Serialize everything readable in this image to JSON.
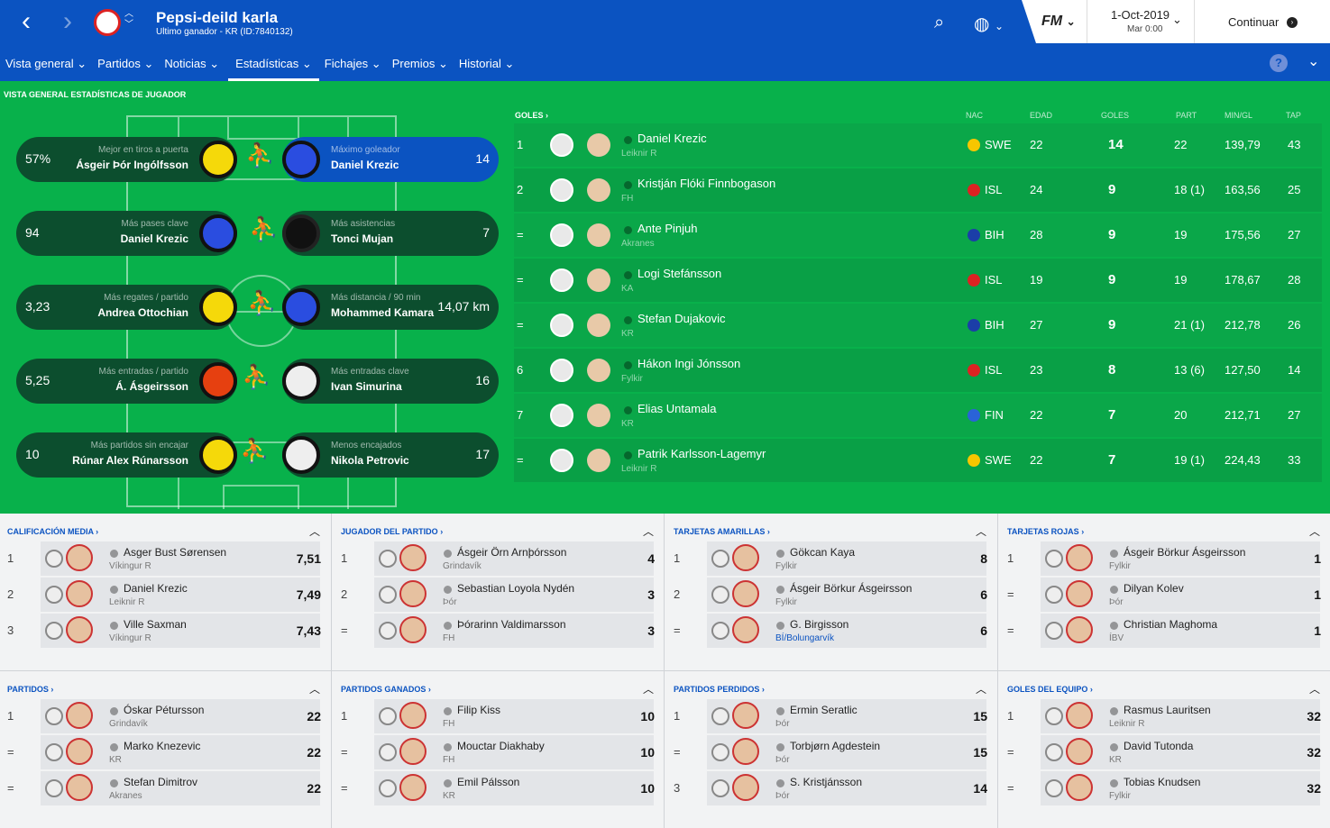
{
  "header": {
    "title": "Pepsi-deild karla",
    "subtitle": "Ultimo ganador - KR (ID:7840132)",
    "fm": "FM",
    "date": "1-Oct-2019",
    "time": "Mar 0:00",
    "continue": "Continuar"
  },
  "tabs": [
    "Vista general",
    "Partidos",
    "Noticias",
    "Estadísticas",
    "Fichajes",
    "Premios",
    "Historial"
  ],
  "section_title": "VISTA GENERAL ESTADÍSTICAS DE JUGADOR",
  "stats": [
    {
      "lval": "57%",
      "lcap": "Mejor en tiros a puerta",
      "lname": "Ásgeir Þór Ingólfsson",
      "rcap": "Máximo goleador",
      "rname": "Daniel Krezic",
      "rval": "14"
    },
    {
      "lval": "94",
      "lcap": "Más pases clave",
      "lname": "Daniel Krezic",
      "rcap": "Más asistencias",
      "rname": "Tonci Mujan",
      "rval": "7"
    },
    {
      "lval": "3,23",
      "lcap": "Más regates / partido",
      "lname": "Andrea Ottochian",
      "rcap": "Más distancia / 90 min",
      "rname": "Mohammed Kamara",
      "rval": "14,07 km"
    },
    {
      "lval": "5,25",
      "lcap": "Más entradas / partido",
      "lname": "Á. Ásgeirsson",
      "rcap": "Más entradas clave",
      "rname": "Ivan Simurina",
      "rval": "16"
    },
    {
      "lval": "10",
      "lcap": "Más partidos sin encajar",
      "lname": "Rúnar Alex Rúnarsson",
      "rcap": "Menos encajados",
      "rname": "Nikola Petrovic",
      "rval": "17"
    }
  ],
  "goals": {
    "title": "GOLES",
    "headers": [
      "NAC",
      "EDAD",
      "GOLES",
      "PART",
      "MIN/GL",
      "TAP"
    ],
    "rows": [
      {
        "rank": "1",
        "name": "Daniel Krezic",
        "club": "Leiknir R",
        "nat": "SWE",
        "age": "22",
        "goals": "14",
        "apps": "22",
        "mpg": "139,79",
        "tap": "43"
      },
      {
        "rank": "2",
        "name": "Kristján Flóki Finnbogason",
        "club": "FH",
        "nat": "ISL",
        "age": "24",
        "goals": "9",
        "apps": "18 (1)",
        "mpg": "163,56",
        "tap": "25"
      },
      {
        "rank": "=",
        "name": "Ante Pinjuh",
        "club": "Akranes",
        "nat": "BIH",
        "age": "28",
        "goals": "9",
        "apps": "19",
        "mpg": "175,56",
        "tap": "27"
      },
      {
        "rank": "=",
        "name": "Logi Stefánsson",
        "club": "KA",
        "nat": "ISL",
        "age": "19",
        "goals": "9",
        "apps": "19",
        "mpg": "178,67",
        "tap": "28"
      },
      {
        "rank": "=",
        "name": "Stefan Dujakovic",
        "club": "KR",
        "nat": "BIH",
        "age": "27",
        "goals": "9",
        "apps": "21 (1)",
        "mpg": "212,78",
        "tap": "26"
      },
      {
        "rank": "6",
        "name": "Hákon Ingi Jónsson",
        "club": "Fylkir",
        "nat": "ISL",
        "age": "23",
        "goals": "8",
        "apps": "13 (6)",
        "mpg": "127,50",
        "tap": "14"
      },
      {
        "rank": "7",
        "name": "Elias Untamala",
        "club": "KR",
        "nat": "FIN",
        "age": "22",
        "goals": "7",
        "apps": "20",
        "mpg": "212,71",
        "tap": "27"
      },
      {
        "rank": "=",
        "name": "Patrik Karlsson-Lagemyr",
        "club": "Leiknir R",
        "nat": "SWE",
        "age": "22",
        "goals": "7",
        "apps": "19 (1)",
        "mpg": "224,43",
        "tap": "33"
      }
    ]
  },
  "panels": [
    {
      "title": "CALIFICACIÓN MEDIA",
      "rows": [
        [
          "1",
          "Asger Bust Sørensen",
          "Víkingur R",
          "7,51"
        ],
        [
          "2",
          "Daniel Krezic",
          "Leiknir R",
          "7,49"
        ],
        [
          "3",
          "Ville Saxman",
          "Víkingur R",
          "7,43"
        ]
      ]
    },
    {
      "title": "JUGADOR DEL PARTIDO",
      "rows": [
        [
          "1",
          "Ásgeir Örn Arnþórsson",
          "Grindavík",
          "4"
        ],
        [
          "2",
          "Sebastian Loyola Nydén",
          "Þór",
          "3"
        ],
        [
          "=",
          "Þórarinn Valdimarsson",
          "FH",
          "3"
        ]
      ]
    },
    {
      "title": "TARJETAS AMARILLAS",
      "rows": [
        [
          "1",
          "Gökcan Kaya",
          "Fylkir",
          "8"
        ],
        [
          "2",
          "Ásgeir Börkur Ásgeirsson",
          "Fylkir",
          "6"
        ],
        [
          "=",
          "G. Birgisson",
          "BÍ/Bolungarvík",
          "6"
        ]
      ]
    },
    {
      "title": "TARJETAS ROJAS",
      "rows": [
        [
          "1",
          "Ásgeir Börkur Ásgeirsson",
          "Fylkir",
          "1"
        ],
        [
          "=",
          "Dilyan Kolev",
          "Þór",
          "1"
        ],
        [
          "=",
          "Christian Maghoma",
          "ÍBV",
          "1"
        ]
      ]
    },
    {
      "title": "PARTIDOS",
      "rows": [
        [
          "1",
          "Óskar Pétursson",
          "Grindavík",
          "22"
        ],
        [
          "=",
          "Marko Knezevic",
          "KR",
          "22"
        ],
        [
          "=",
          "Stefan Dimitrov",
          "Akranes",
          "22"
        ]
      ]
    },
    {
      "title": "PARTIDOS GANADOS",
      "rows": [
        [
          "1",
          "Filip Kiss",
          "FH",
          "10"
        ],
        [
          "=",
          "Mouctar Diakhaby",
          "FH",
          "10"
        ],
        [
          "=",
          "Emil Pálsson",
          "KR",
          "10"
        ]
      ]
    },
    {
      "title": "PARTIDOS PERDIDOS",
      "rows": [
        [
          "1",
          "Ermin Seratlic",
          "Þór",
          "15"
        ],
        [
          "=",
          "Torbjørn Agdestein",
          "Þór",
          "15"
        ],
        [
          "3",
          "S. Kristjánsson",
          "Þór",
          "14"
        ]
      ]
    },
    {
      "title": "GOLES DEL EQUIPO",
      "rows": [
        [
          "1",
          "Rasmus Lauritsen",
          "Leiknir R",
          "32"
        ],
        [
          "=",
          "David Tutonda",
          "KR",
          "32"
        ],
        [
          "=",
          "Tobias Knudsen",
          "Fylkir",
          "32"
        ]
      ]
    }
  ]
}
